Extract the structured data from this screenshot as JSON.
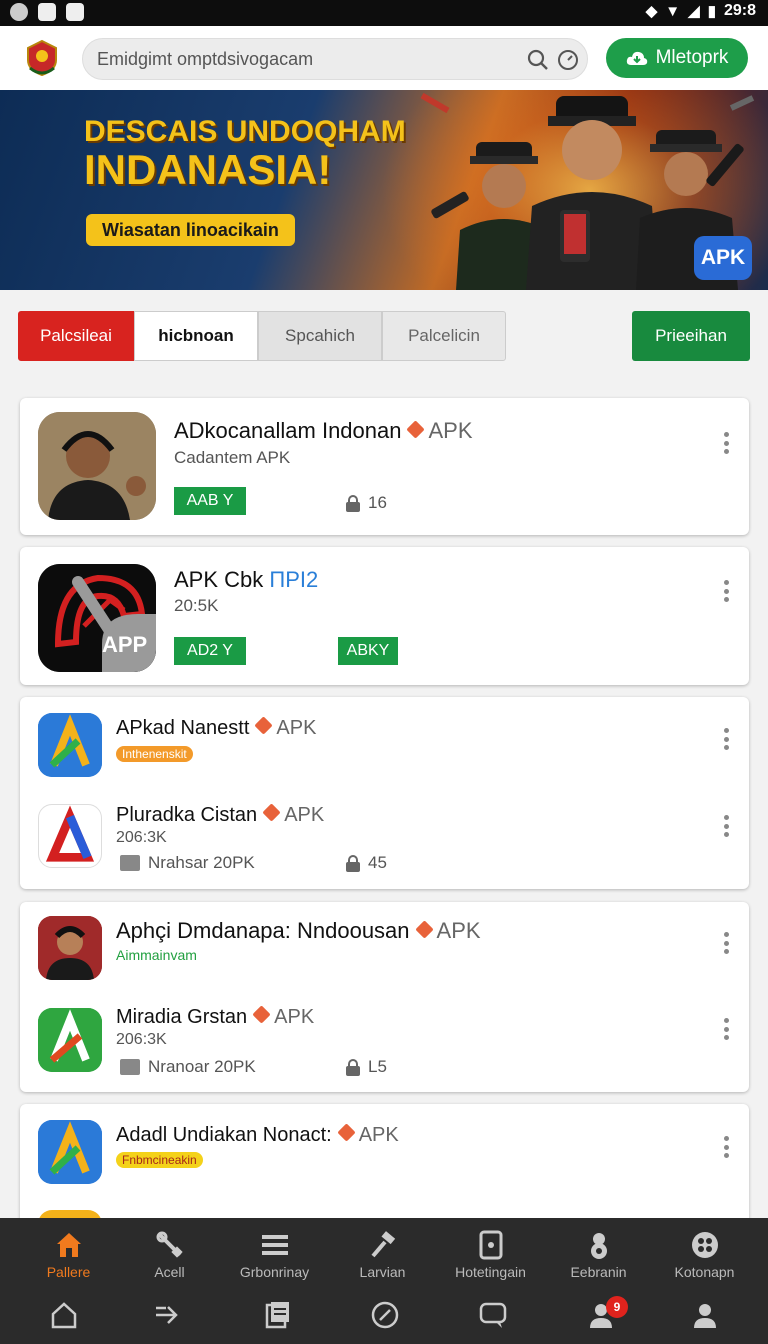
{
  "status_bar": {
    "time": "29:8"
  },
  "header": {
    "search_placeholder": "Emidgimt omptdsivogacam",
    "main_button_label": "Mletoprk"
  },
  "banner": {
    "title_line1": "DESCAIS UNDOQHAM",
    "title_line2": "INDANASIA!",
    "subtitle": "Wiasatan linoacikain",
    "badge": "APK"
  },
  "tabs": [
    {
      "label": "Palcsileai"
    },
    {
      "label": "hicbnoan"
    },
    {
      "label": "Spcahich"
    },
    {
      "label": "Palcelicin"
    }
  ],
  "filter_button": "Prieeihan",
  "apps": {
    "a1": {
      "title": "ADkocanallam Indonan",
      "apk": "APK",
      "subtitle": "Cadantem APK",
      "badge": "AAB Y",
      "count": "16"
    },
    "a2": {
      "title": "APK Cbk",
      "title_accent": "ПPI2",
      "size": "20:5K",
      "badge1": "AD2 Y",
      "badge2": "ABKY",
      "icon_text": "APP"
    },
    "a3": {
      "title": "APkad Nanestt",
      "apk": "APK",
      "tag": "Inthenenskit"
    },
    "a4": {
      "title": "Pluradka Cistan",
      "apk": "APK",
      "size": "206:3K",
      "meta": "Nrahsar 20PK",
      "count": "45"
    },
    "a5": {
      "title": "Aphçi Dmdanapa: Nndoousan",
      "apk": "APK",
      "green": "Aimmainvam"
    },
    "a6": {
      "title": "Miradia Grstan",
      "apk": "APK",
      "size": "206:3K",
      "meta": "Nranoar 20PK",
      "count": "L5"
    },
    "a7": {
      "title": "Adadl Undiakan Nonact:",
      "apk": "APK",
      "tag": "Fnbmcineakin"
    }
  },
  "bottom_nav": [
    {
      "label": "Pallere",
      "icon": "home-icon",
      "active": true
    },
    {
      "label": "Acell",
      "icon": "tools-icon"
    },
    {
      "label": "Grbonrinay",
      "icon": "list-icon"
    },
    {
      "label": "Larvian",
      "icon": "hammer-icon"
    },
    {
      "label": "Hotetingain",
      "icon": "tablet-icon"
    },
    {
      "label": "Eebranin",
      "icon": "person-icon"
    },
    {
      "label": "Kotonapn",
      "icon": "grid-icon"
    }
  ],
  "notification_count": "9",
  "colors": {
    "accent_green": "#1e9e4a",
    "accent_red": "#d8231f",
    "accent_orange": "#f07a1e",
    "banner_yellow": "#f4c21a"
  }
}
